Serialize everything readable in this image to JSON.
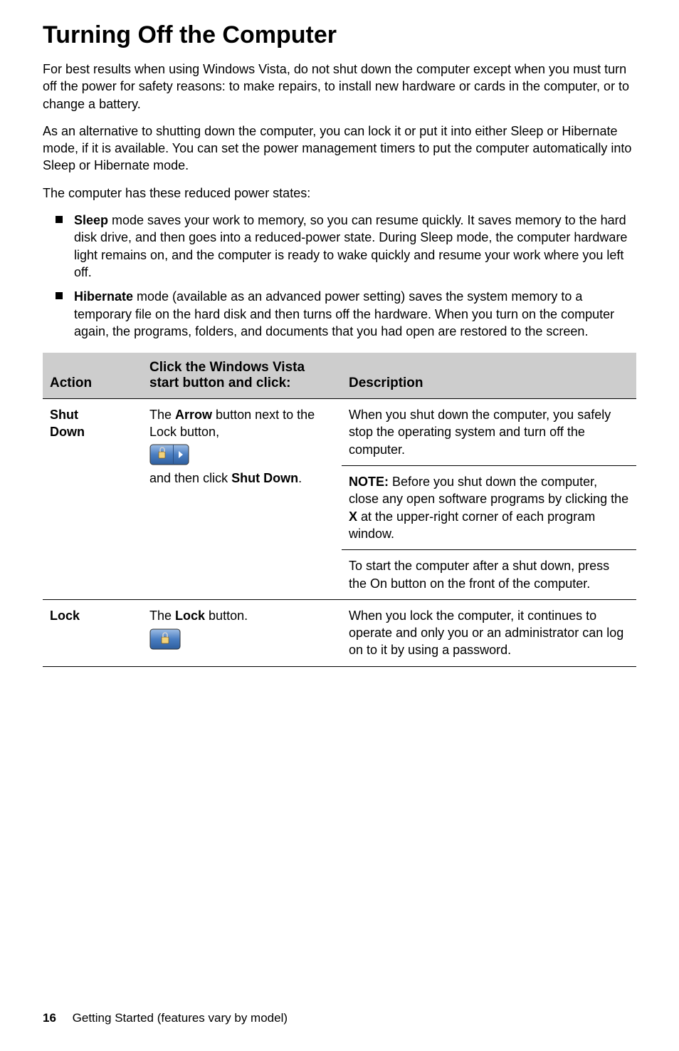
{
  "heading": "Turning Off the Computer",
  "para1": "For best results when using Windows Vista, do not shut down the computer except when you must turn off the power for safety reasons: to make repairs, to install new hardware or cards in the computer, or to change a battery.",
  "para2": "As an alternative to shutting down the computer, you can lock it or put it into either Sleep or Hibernate mode, if it is available. You can set the power management timers to put the computer automatically into Sleep or Hibernate mode.",
  "para3": "The computer has these reduced power states:",
  "bullets": {
    "sleep": {
      "label": "Sleep",
      "text": " mode saves your work to memory, so you can resume quickly. It saves memory to the hard disk drive, and then goes into a reduced-power state. During Sleep mode, the computer hardware light remains on, and the computer is ready to wake quickly and resume your work where you left off."
    },
    "hibernate": {
      "label": "Hibernate",
      "text": " mode (available as an advanced power setting) saves the system memory to a temporary file on the hard disk and then turns off the hardware. When you turn on the computer again, the programs, folders, and documents that you had open are restored to the screen."
    }
  },
  "table": {
    "headers": {
      "action": "Action",
      "instruction": "Click the Windows Vista start button and click:",
      "description": "Description"
    },
    "rows": {
      "shutdown": {
        "action_line1": "Shut",
        "action_line2": "Down",
        "inst_pre": "The ",
        "inst_arrow": "Arrow",
        "inst_post1": " button next to the Lock button,",
        "inst_post2_pre": "and then click ",
        "inst_post2_bold": "Shut Down",
        "inst_post2_post": ".",
        "desc1": "When you shut down the computer, you safely stop the operating system and turn off the computer.",
        "desc2_pre": "NOTE:",
        "desc2_mid": " Before you shut down the computer, close any open software programs by clicking the ",
        "desc2_x": "X",
        "desc2_post": " at the upper-right corner of each program window.",
        "desc3": "To start the computer after a shut down, press the On button on the front of the computer."
      },
      "lock": {
        "action": "Lock",
        "inst_pre": "The ",
        "inst_bold": "Lock",
        "inst_post": " button.",
        "desc": "When you lock the computer, it continues to operate and only you or an administrator can log on to it by using a password."
      }
    }
  },
  "footer": {
    "page": "16",
    "text": "Getting Started (features vary by model)"
  }
}
